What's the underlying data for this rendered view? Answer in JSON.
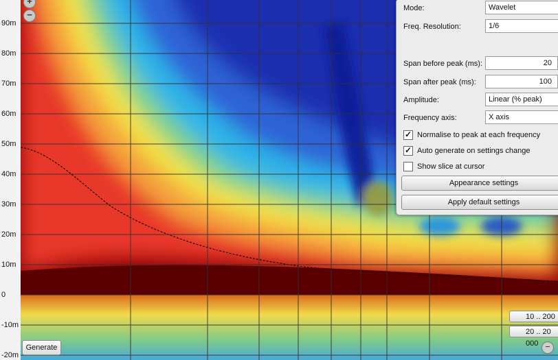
{
  "y_axis_labels": [
    "90m",
    "80m",
    "70m",
    "60m",
    "50m",
    "40m",
    "30m",
    "20m",
    "10m",
    "0",
    "-10m",
    "-20m"
  ],
  "zoom": {
    "in_glyph": "+",
    "out_glyph": "−"
  },
  "buttons": {
    "generate": "Generate",
    "range_low": "10 .. 200",
    "range_high": "20 .. 20 000",
    "minus_glyph": "−"
  },
  "settings": {
    "mode_label": "Mode:",
    "mode_value": "Wavelet",
    "freq_res_label": "Freq. Resolution:",
    "freq_res_value": "1/6",
    "span_before_label": "Span before peak (ms):",
    "span_before_value": "20",
    "span_after_label": "Span after peak (ms):",
    "span_after_value": "100",
    "amplitude_label": "Amplitude:",
    "amplitude_value": "Linear (% peak)",
    "freq_axis_label": "Frequency axis:",
    "freq_axis_value": "X axis",
    "normalise_label": "Normalise to peak at each frequency",
    "normalise_checked": true,
    "autogen_label": "Auto generate on settings change",
    "autogen_checked": true,
    "slice_label": "Show slice at cursor",
    "slice_checked": false,
    "appearance_btn": "Appearance settings",
    "default_btn": "Apply default settings"
  },
  "icons": {
    "check_glyph": "✓",
    "dropdown": "chevron-down-icon"
  }
}
